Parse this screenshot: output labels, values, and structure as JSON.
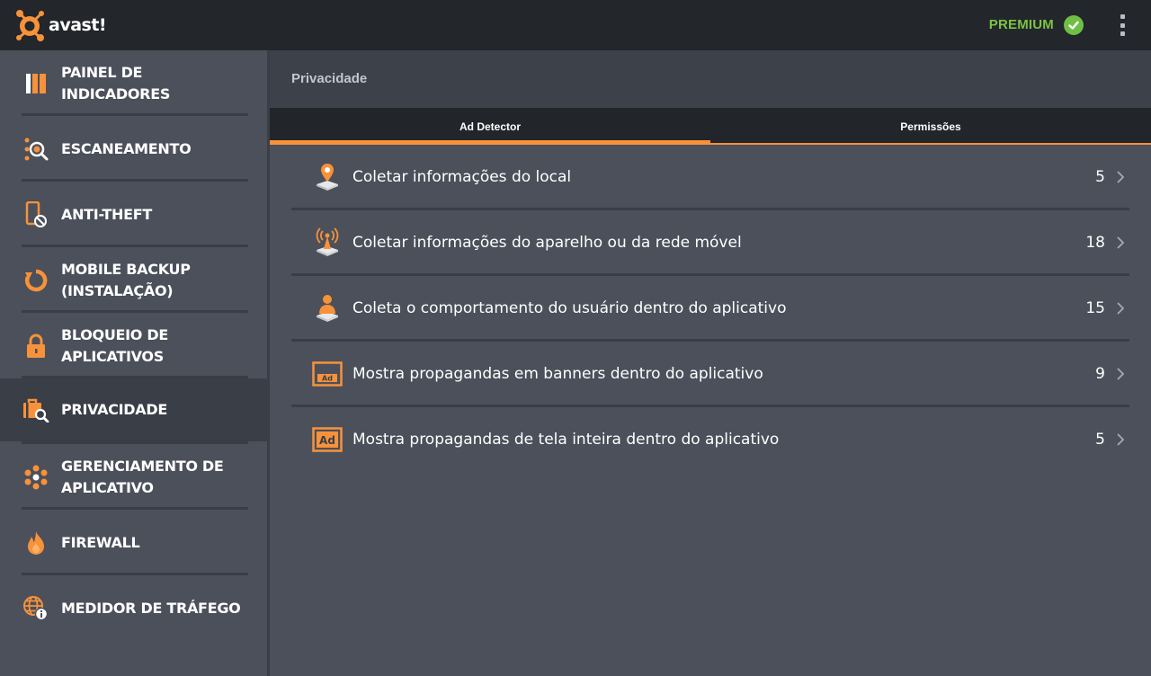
{
  "app": {
    "logo_text": "avast!",
    "premium_label": "PREMIUM",
    "accent_color": "#f7923a",
    "premium_color": "#7cc242"
  },
  "sidebar": {
    "items": [
      {
        "label": "PAINEL DE INDICADORES",
        "icon": "dashboard-icon",
        "active": false
      },
      {
        "label": "ESCANEAMENTO",
        "icon": "scan-icon",
        "active": false
      },
      {
        "label": "ANTI-THEFT",
        "icon": "anti-theft-phone-icon",
        "active": false
      },
      {
        "label": "MOBILE BACKUP (INSTALAÇÃO)",
        "icon": "backup-icon",
        "active": false
      },
      {
        "label": "BLOQUEIO DE APLICATIVOS",
        "icon": "lock-icon",
        "active": false
      },
      {
        "label": "PRIVACIDADE",
        "icon": "privacy-icon",
        "active": true
      },
      {
        "label": "GERENCIAMENTO DE APLICATIVO",
        "icon": "app-manager-icon",
        "active": false
      },
      {
        "label": "FIREWALL",
        "icon": "fire-icon",
        "active": false
      },
      {
        "label": "MEDIDOR DE TRÁFEGO",
        "icon": "globe-info-icon",
        "active": false
      }
    ]
  },
  "main": {
    "title": "Privacidade",
    "tabs": [
      {
        "label": "Ad Detector",
        "active": true
      },
      {
        "label": "Permissões",
        "active": false
      }
    ],
    "rows": [
      {
        "label": "Coletar informações do local",
        "count": "5",
        "icon": "location-pin-icon"
      },
      {
        "label": "Coletar informações do aparelho ou da rede móvel",
        "count": "18",
        "icon": "antenna-icon"
      },
      {
        "label": "Coleta o comportamento do usuário dentro do aplicativo",
        "count": "15",
        "icon": "user-icon"
      },
      {
        "label": "Mostra propagandas em banners dentro do aplicativo",
        "count": "9",
        "icon": "ad-banner-icon"
      },
      {
        "label": "Mostra propagandas de tela inteira dentro do aplicativo",
        "count": "5",
        "icon": "ad-fullscreen-icon"
      }
    ]
  }
}
